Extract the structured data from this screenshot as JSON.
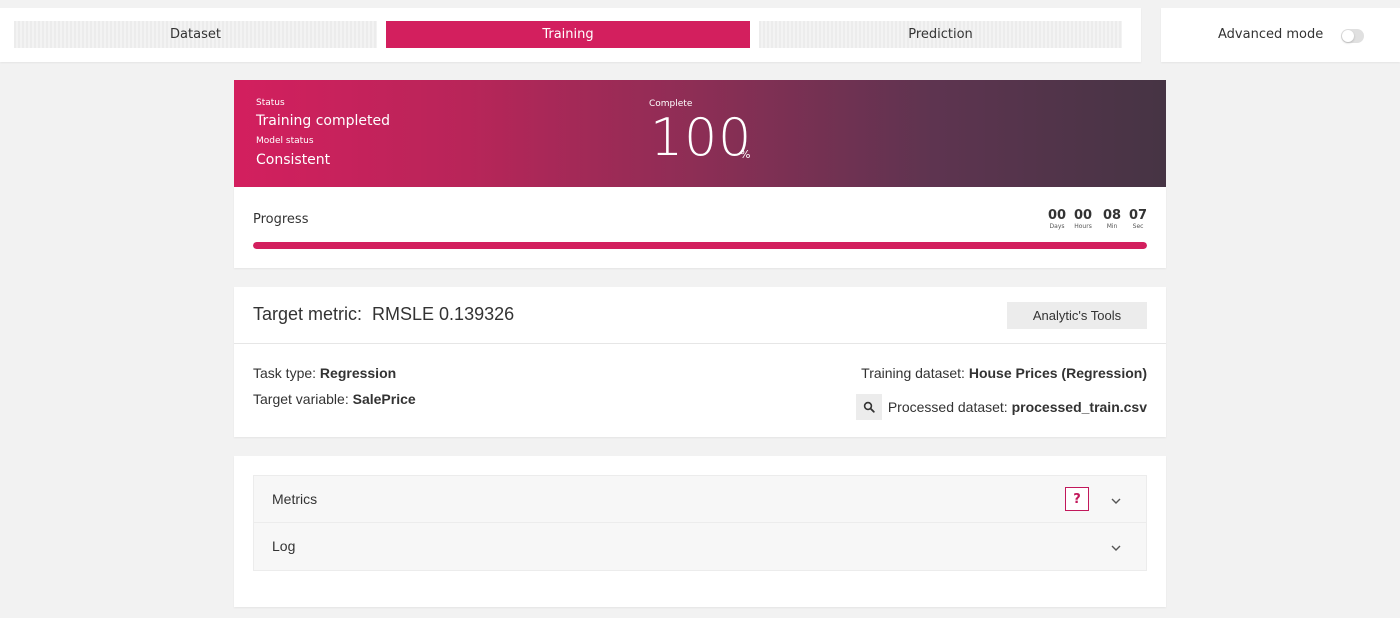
{
  "tabs": {
    "dataset": "Dataset",
    "training": "Training",
    "prediction": "Prediction"
  },
  "advanced_mode": {
    "label": "Advanced mode",
    "enabled": false
  },
  "status_banner": {
    "status_label": "Status",
    "status_value": "Training completed",
    "model_status_label": "Model status",
    "model_status_value": "Consistent",
    "complete_label": "Complete",
    "complete_value": "100",
    "complete_unit": "%"
  },
  "progress": {
    "label": "Progress",
    "percent": 100,
    "timer": {
      "days": "00",
      "days_label": "Days",
      "hours": "00",
      "hours_label": "Hours",
      "min": "08",
      "min_label": "Min",
      "sec": "07",
      "sec_label": "Sec"
    }
  },
  "target_metric": {
    "label": "Target metric:",
    "value": "RMSLE 0.139326",
    "analytic_tools_label": "Analytic's Tools"
  },
  "details": {
    "task_type_label": "Task type:",
    "task_type_value": "Regression",
    "target_variable_label": "Target variable:",
    "target_variable_value": "SalePrice",
    "training_dataset_label": "Training dataset:",
    "training_dataset_value": "House Prices (Regression)",
    "processed_dataset_label": "Processed dataset:",
    "processed_dataset_value": "processed_train.csv"
  },
  "accordion": {
    "metrics_label": "Metrics",
    "help_label": "?",
    "log_label": "Log"
  },
  "colors": {
    "accent": "#d31f5e",
    "banner_end": "#463444"
  }
}
